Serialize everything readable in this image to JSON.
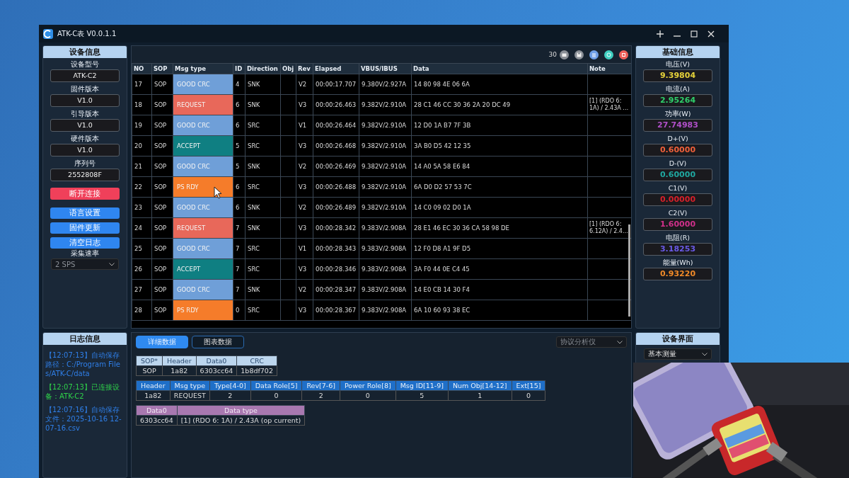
{
  "window": {
    "title": "ATK-C表 V0.0.1.1"
  },
  "device_info": {
    "title": "设备信息",
    "fields": [
      {
        "label": "设备型号",
        "value": "ATK-C2"
      },
      {
        "label": "固件版本",
        "value": "V1.0"
      },
      {
        "label": "引导版本",
        "value": "V1.0"
      },
      {
        "label": "硬件版本",
        "value": "V1.0"
      },
      {
        "label": "序列号",
        "value": "2552808F"
      }
    ],
    "buttons": [
      {
        "label": "断开连接",
        "kind": "danger"
      },
      {
        "label": "语言设置",
        "kind": "primary"
      },
      {
        "label": "固件更新",
        "kind": "primary"
      },
      {
        "label": "清空日志",
        "kind": "primary"
      }
    ],
    "sample_rate": {
      "label": "采集速率",
      "value": "2 SPS",
      "disabled": true
    }
  },
  "toolbar": {
    "count": "30"
  },
  "table": {
    "columns": [
      "NO",
      "SOP",
      "Msg type",
      "ID",
      "Direction",
      "Obj",
      "Rev",
      "Elapsed",
      "VBUS/IBUS",
      "Data",
      "Note"
    ],
    "rows": [
      {
        "no": "17",
        "sop": "SOP",
        "msg": "GOOD CRC",
        "color": "#6f9fd8",
        "id": "4",
        "dir": "SNK",
        "rev": "V2",
        "elapsed": "00:00:17.707",
        "vbus": "9.380V/2.927A",
        "data": "14 80 98 4E 06 6A"
      },
      {
        "no": "18",
        "sop": "SOP",
        "msg": "REQUEST",
        "color": "#e8685a",
        "id": "6",
        "dir": "SNK",
        "rev": "V3",
        "elapsed": "00:00:26.463",
        "vbus": "9.382V/2.910A",
        "data": "28 C1 46 CC 30 36 2A 20 DC 49",
        "note": "[1] (RDO 6: 1A) / 2.43A …"
      },
      {
        "no": "19",
        "sop": "SOP",
        "msg": "GOOD CRC",
        "color": "#6f9fd8",
        "id": "6",
        "dir": "SRC",
        "rev": "V1",
        "elapsed": "00:00:26.464",
        "vbus": "9.382V/2.910A",
        "data": "12 D0 1A B7 7F 3B"
      },
      {
        "no": "20",
        "sop": "SOP",
        "msg": "ACCEPT",
        "color": "#0f7f82",
        "id": "5",
        "dir": "SRC",
        "rev": "V3",
        "elapsed": "00:00:26.468",
        "vbus": "9.382V/2.910A",
        "data": "3A B0 D5 42 12 35"
      },
      {
        "no": "21",
        "sop": "SOP",
        "msg": "GOOD CRC",
        "color": "#6f9fd8",
        "id": "5",
        "dir": "SNK",
        "rev": "V2",
        "elapsed": "00:00:26.469",
        "vbus": "9.382V/2.910A",
        "data": "14 A0 5A 58 E6 84"
      },
      {
        "no": "22",
        "sop": "SOP",
        "msg": "PS RDY",
        "color": "#f57c2a",
        "id": "6",
        "dir": "SRC",
        "rev": "V3",
        "elapsed": "00:00:26.488",
        "vbus": "9.382V/2.910A",
        "data": "6A D0 D2 57 53 7C"
      },
      {
        "no": "23",
        "sop": "SOP",
        "msg": "GOOD CRC",
        "color": "#6f9fd8",
        "id": "6",
        "dir": "SNK",
        "rev": "V2",
        "elapsed": "00:00:26.489",
        "vbus": "9.382V/2.910A",
        "data": "14 C0 09 02 D0 1A"
      },
      {
        "no": "24",
        "sop": "SOP",
        "msg": "REQUEST",
        "color": "#e8685a",
        "id": "7",
        "dir": "SNK",
        "rev": "V3",
        "elapsed": "00:00:28.342",
        "vbus": "9.383V/2.908A",
        "data": "28 E1 46 EC 30 36 CA 58 98 DE",
        "note": "[1] (RDO 6: 6.12A) / 2.4…"
      },
      {
        "no": "25",
        "sop": "SOP",
        "msg": "GOOD CRC",
        "color": "#6f9fd8",
        "id": "7",
        "dir": "SRC",
        "rev": "V1",
        "elapsed": "00:00:28.343",
        "vbus": "9.383V/2.908A",
        "data": "12 F0 D8 A1 9F D5"
      },
      {
        "no": "26",
        "sop": "SOP",
        "msg": "ACCEPT",
        "color": "#0f7f82",
        "id": "7",
        "dir": "SRC",
        "rev": "V3",
        "elapsed": "00:00:28.346",
        "vbus": "9.383V/2.908A",
        "data": "3A F0 44 0E C4 45"
      },
      {
        "no": "27",
        "sop": "SOP",
        "msg": "GOOD CRC",
        "color": "#6f9fd8",
        "id": "7",
        "dir": "SNK",
        "rev": "V2",
        "elapsed": "00:00:28.347",
        "vbus": "9.383V/2.908A",
        "data": "14 E0 CB 14 30 F4"
      },
      {
        "no": "28",
        "sop": "SOP",
        "msg": "PS RDY",
        "color": "#f57c2a",
        "id": "0",
        "dir": "SRC",
        "rev": "V3",
        "elapsed": "00:00:28.367",
        "vbus": "9.383V/2.908A",
        "data": "6A 10 60 93 38 EC"
      }
    ]
  },
  "basic_info": {
    "title": "基础信息",
    "items": [
      {
        "label": "电压(V)",
        "value": "9.39804",
        "color": "#e6d23a"
      },
      {
        "label": "电流(A)",
        "value": "2.95264",
        "color": "#2fcf6a"
      },
      {
        "label": "功率(W)",
        "value": "27.74983",
        "color": "#b04fc8"
      },
      {
        "label": "D+(V)",
        "value": "0.60000",
        "color": "#f0603a"
      },
      {
        "label": "D-(V)",
        "value": "0.60000",
        "color": "#1fa8a0"
      },
      {
        "label": "C1(V)",
        "value": "0.00000",
        "color": "#d8202a"
      },
      {
        "label": "C2(V)",
        "value": "1.60000",
        "color": "#d0308a"
      },
      {
        "label": "电阻(R)",
        "value": "3.18253",
        "color": "#6a5ae8"
      },
      {
        "label": "能量(Wh)",
        "value": "0.93220",
        "color": "#f08a28"
      }
    ]
  },
  "log": {
    "title": "日志信息",
    "entries": [
      {
        "text": "【12:07:13】自动保存路径：C:/Program Files/ATK-C/data",
        "color": "#2f7fe8"
      },
      {
        "text": "【12:07:13】已连接设备：ATK-C2",
        "color": "#2fd04a"
      },
      {
        "text": "【12:07:16】自动保存文件：2025-10-16 12-07-16.csv",
        "color": "#2f7fe8"
      }
    ]
  },
  "detail": {
    "tabs": [
      {
        "label": "详细数据",
        "selected": true
      },
      {
        "label": "图表数据",
        "selected": false
      }
    ],
    "mode_select": {
      "value": "协议分析仪",
      "disabled": true
    },
    "tables": [
      {
        "kind": "packet",
        "columns": [
          "SOP*",
          "Header",
          "Data0",
          "CRC"
        ],
        "rows": [
          [
            "SOP",
            "1a82",
            "6303cc64",
            "1b8df702"
          ]
        ]
      },
      {
        "kind": "header",
        "columns": [
          "Header",
          "Msg type",
          "Type[4-0]",
          "Data Role[5]",
          "Rev[7-6]",
          "Power Role[8]",
          "Msg ID[11-9]",
          "Num Obj[14-12]",
          "Ext[15]"
        ],
        "rows": [
          [
            "1a82",
            "REQUEST",
            "2",
            "0",
            "2",
            "0",
            "5",
            "1",
            "0"
          ]
        ]
      },
      {
        "kind": "data",
        "columns": [
          "Data0",
          "Data type"
        ],
        "rows": [
          [
            "6303cc64",
            "[1] (RDO 6: 1A) / 2.43A (op current)"
          ]
        ]
      }
    ]
  },
  "device_view": {
    "title": "设备界面",
    "select": {
      "value": "基本测量"
    }
  }
}
